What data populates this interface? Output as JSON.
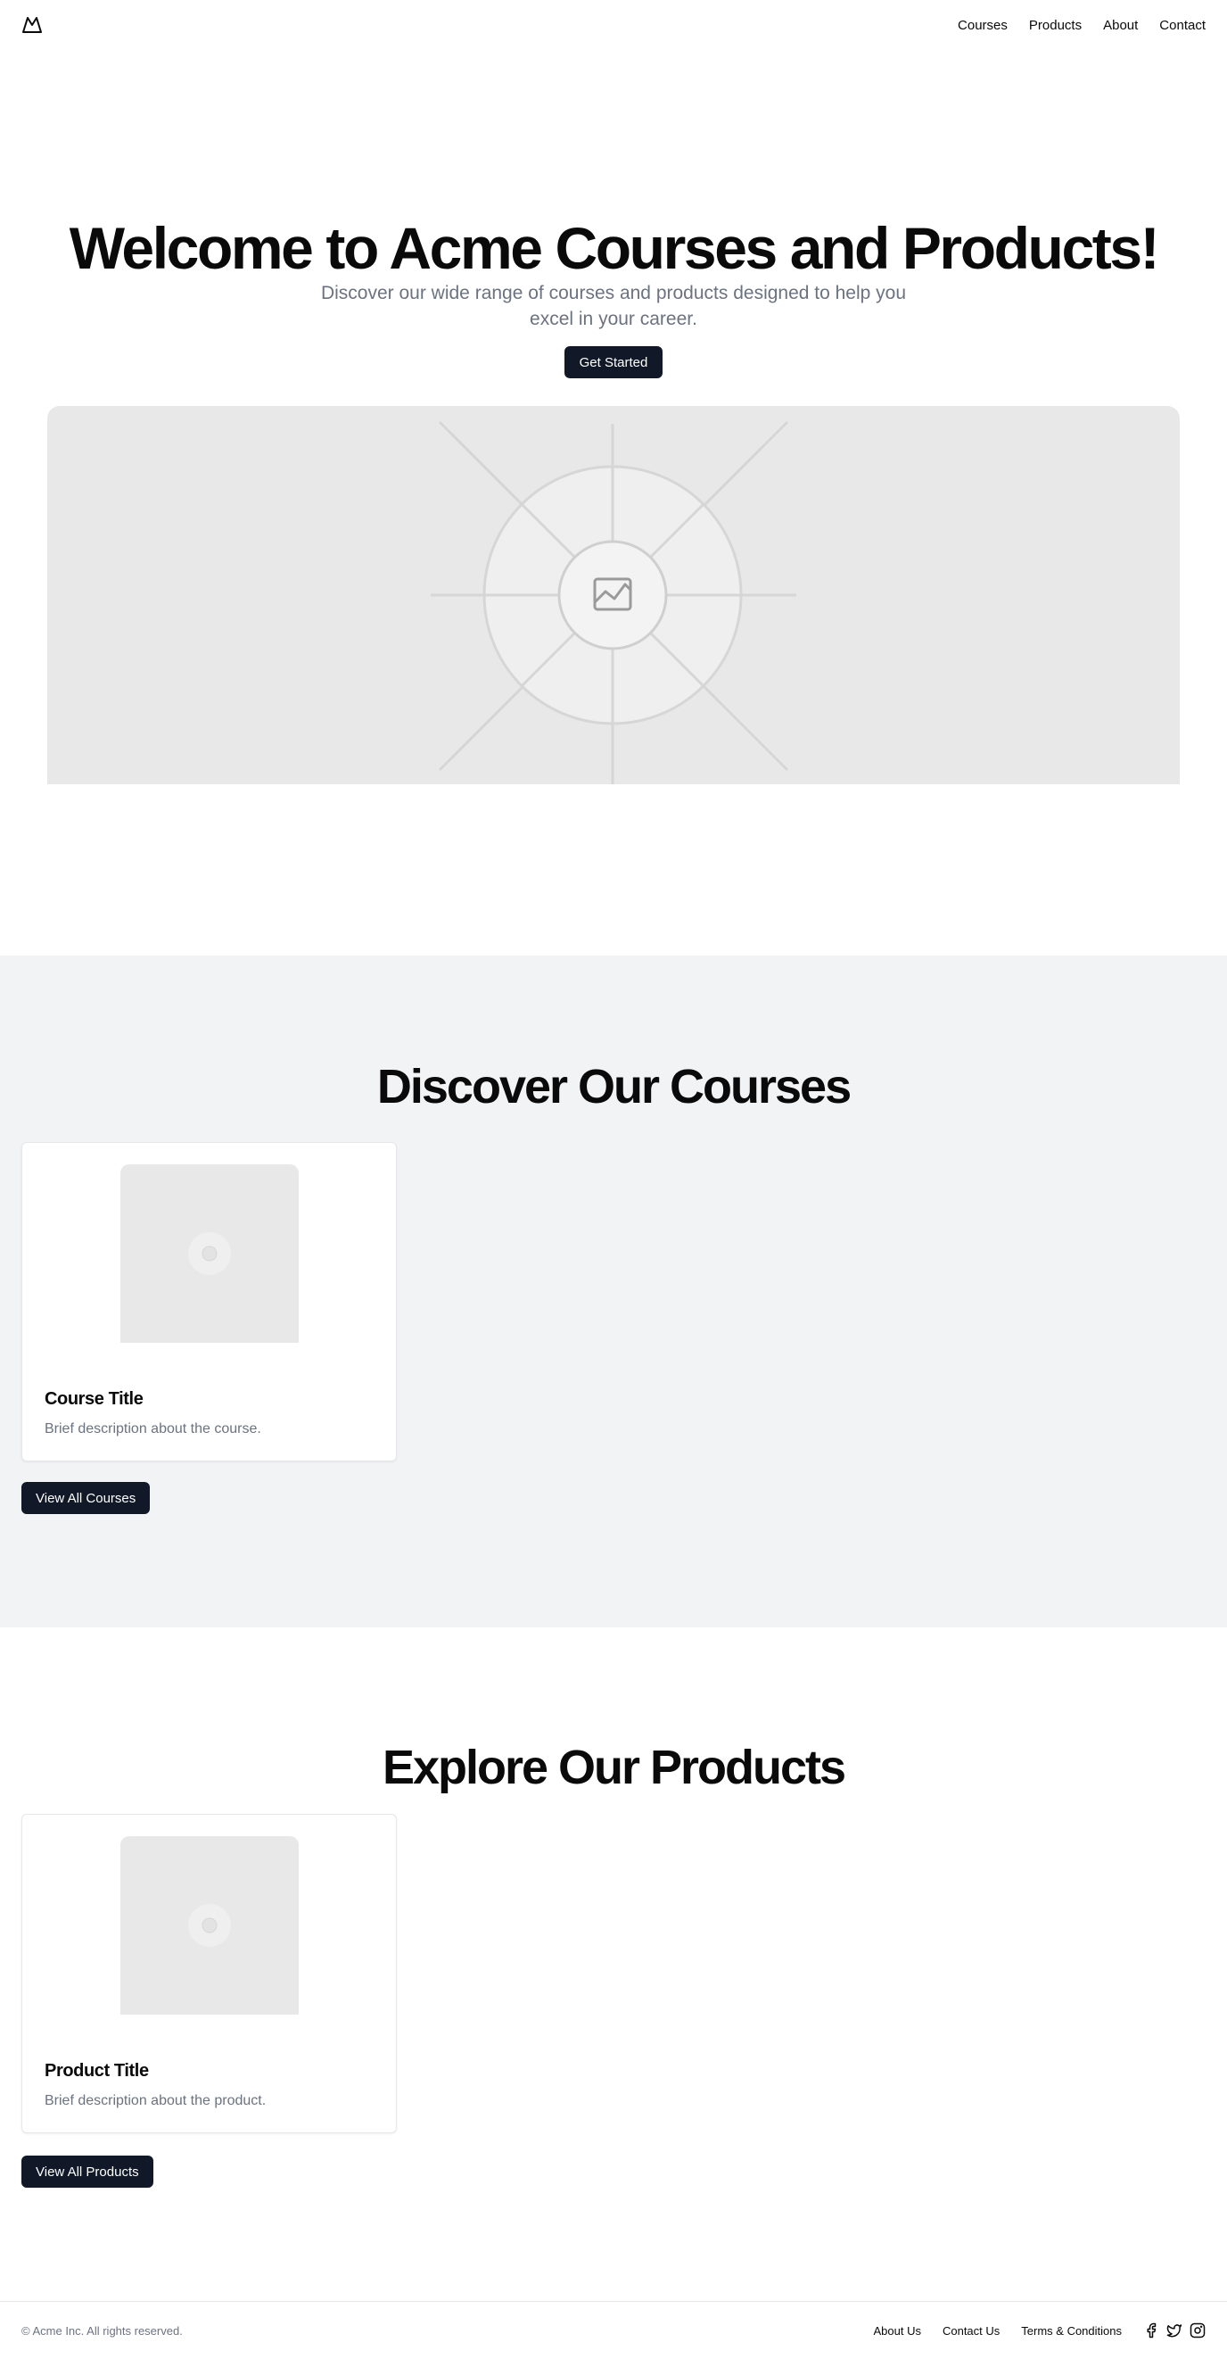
{
  "header": {
    "logo": "mountain-logo-icon",
    "nav": [
      "Courses",
      "Products",
      "About",
      "Contact"
    ]
  },
  "hero": {
    "title": "Welcome to Acme Courses and Products!",
    "subtitle": "Discover our wide range of courses and products designed to help you excel in your career.",
    "cta_label": "Get Started",
    "image": "placeholder-image-icon"
  },
  "courses": {
    "title": "Discover Our Courses",
    "card": {
      "title": "Course Title",
      "description": "Brief description about the course."
    },
    "button_label": "View All Courses"
  },
  "products": {
    "title": "Explore Our Products",
    "card": {
      "title": "Product Title",
      "description": "Brief description about the product."
    },
    "button_label": "View All Products"
  },
  "footer": {
    "copyright": "© Acme Inc. All rights reserved.",
    "links": [
      "About Us",
      "Contact Us",
      "Terms & Conditions"
    ],
    "social_icons": [
      "facebook-icon",
      "twitter-icon",
      "instagram-icon"
    ]
  },
  "colors": {
    "primary_button": "#111827",
    "muted_text": "#6b7280",
    "section_bg": "#f2f3f5",
    "placeholder_bg": "#e8e8e8"
  }
}
